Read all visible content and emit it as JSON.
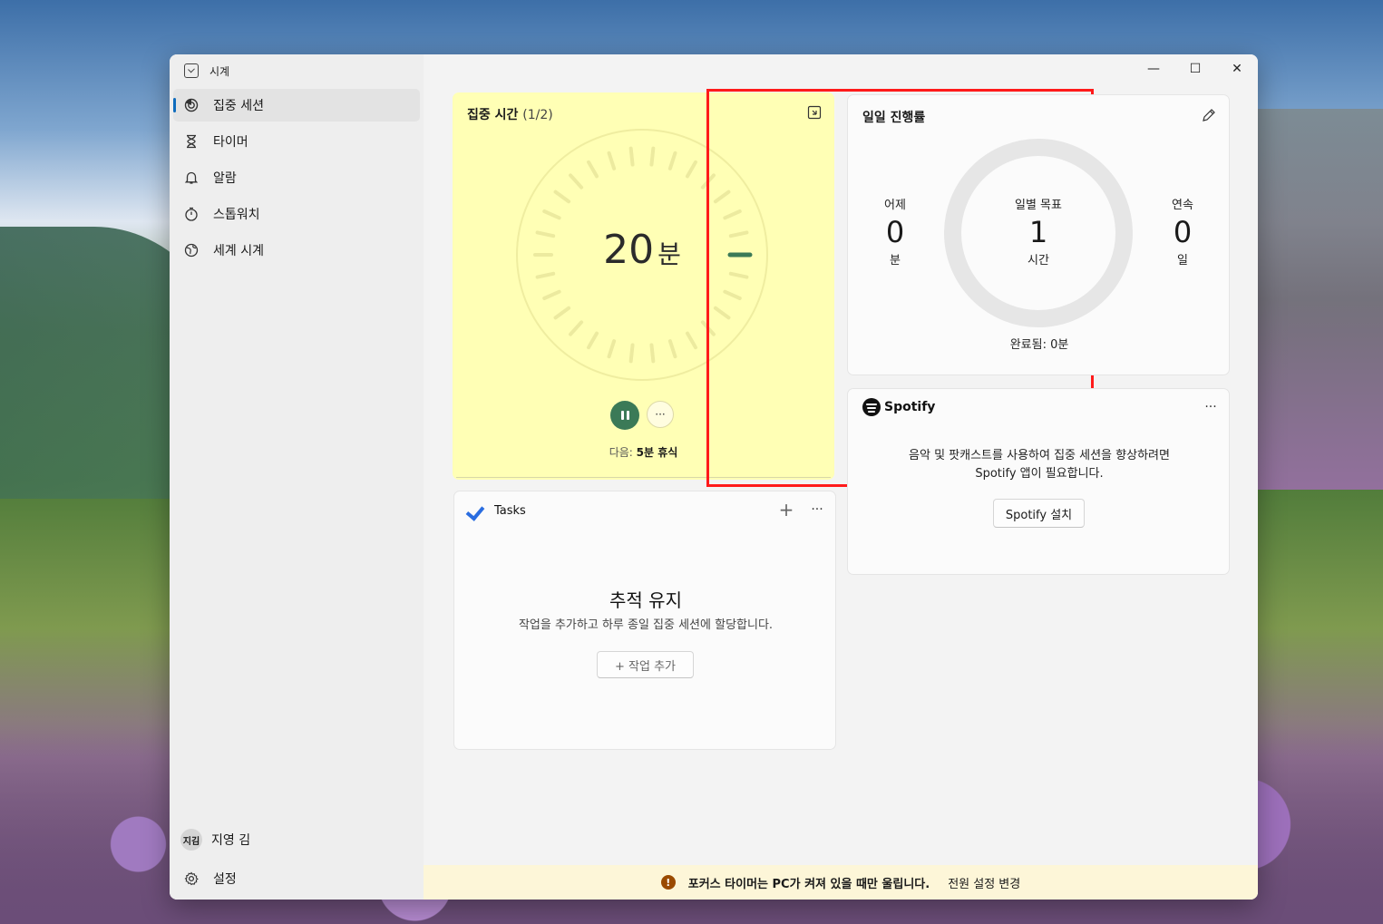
{
  "app": {
    "title": "시계"
  },
  "nav": [
    {
      "label": "집중 세션",
      "icon": "focus-icon",
      "active": true
    },
    {
      "label": "타이머",
      "icon": "hourglass-icon"
    },
    {
      "label": "알람",
      "icon": "bell-icon"
    },
    {
      "label": "스톱워치",
      "icon": "stopwatch-icon"
    },
    {
      "label": "세계 시계",
      "icon": "globe-icon"
    }
  ],
  "user": {
    "initials": "지김",
    "name": "지영 김"
  },
  "settings": {
    "label": "설정",
    "icon": "gear-icon"
  },
  "focus": {
    "title": "집중 시간",
    "session": "(1/2)",
    "value": "20",
    "unit": "분",
    "next_prefix": "다음:",
    "next_value": "5분 휴식",
    "more": "···",
    "accent": "#3b7a57",
    "background": "#ffffb5"
  },
  "progress": {
    "title": "일일 진행률",
    "yesterday": {
      "label": "어제",
      "value": "0",
      "unit": "분"
    },
    "goal": {
      "label": "일별 목표",
      "value": "1",
      "unit": "시간"
    },
    "streak": {
      "label": "연속",
      "value": "0",
      "unit": "일"
    },
    "completed": "완료됨: 0분"
  },
  "spotify": {
    "brand": "Spotify",
    "message_line1": "음악 및 팟캐스트를 사용하여 집중 세션을 향상하려면",
    "message_line2": "Spotify 앱이 필요합니다.",
    "install": "Spotify 설치",
    "more": "···"
  },
  "tasks": {
    "title": "Tasks",
    "add": "+",
    "more": "···",
    "empty_title": "추적 유지",
    "empty_desc": "작업을 추가하고 하루 종일 집중 세션에 할당합니다.",
    "add_task": "+  작업 추가"
  },
  "banner": {
    "message": "포커스 타이머는 PC가 켜져 있을 때만 울립니다.",
    "link": "전원 설정 변경",
    "icon": "!"
  },
  "window": {
    "minimize": "—",
    "maximize": "☐",
    "close": "✕"
  }
}
